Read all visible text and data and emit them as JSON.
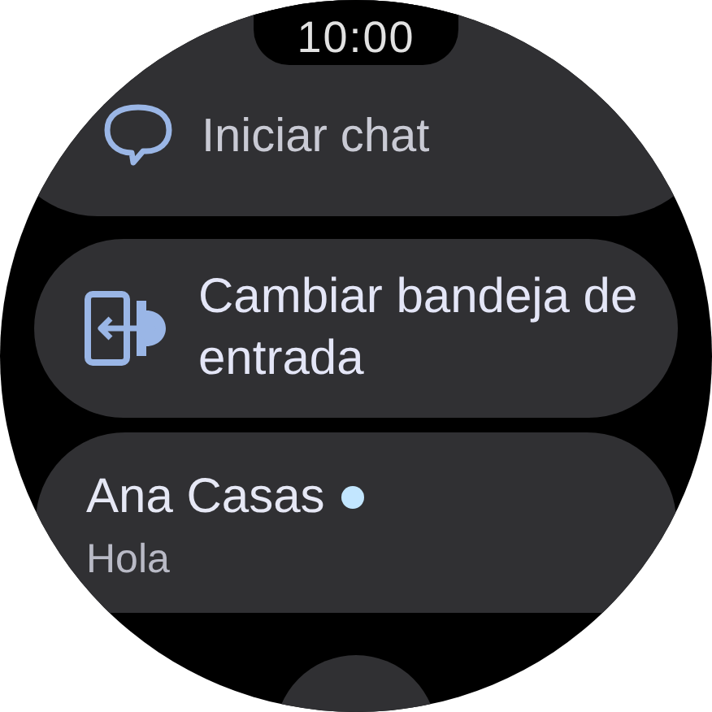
{
  "status": {
    "time": "10:00"
  },
  "actions": [
    {
      "kind": "chat",
      "label": "Iniciar chat"
    },
    {
      "kind": "switch_inbox",
      "label": "Cambiar bandeja de entrada"
    }
  ],
  "conversations": [
    {
      "name": "Ana Casas",
      "preview": "Hola",
      "unread": true
    }
  ]
}
